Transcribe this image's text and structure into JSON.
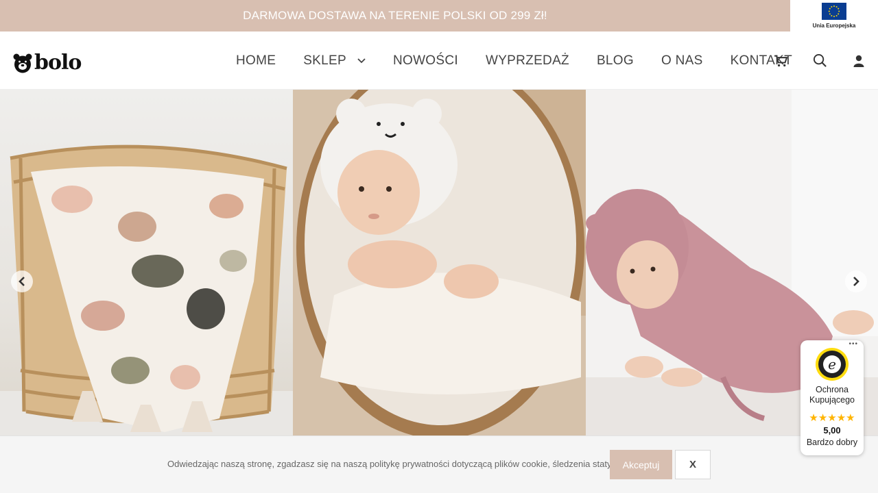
{
  "topbar": {
    "promo_text": "DARMOWA DOSTAWA NA TERENIE POLSKI OD 299 Zł!",
    "eu_label": "Unia Europejska"
  },
  "header": {
    "logo_text": "bolo",
    "nav": [
      {
        "label": "HOME"
      },
      {
        "label": "SKLEP"
      },
      {
        "label": "NOWOŚCI"
      },
      {
        "label": "WYPRZEDAŻ"
      },
      {
        "label": "BLOG"
      },
      {
        "label": "O NAS"
      },
      {
        "label": "KONTAKT"
      }
    ],
    "icons": [
      "cart-icon",
      "search-icon",
      "user-icon"
    ]
  },
  "hero": {
    "slides": [
      "blanket-in-basket",
      "baby-hooded-towel",
      "baby-pink-bathrobe"
    ]
  },
  "cookie": {
    "text": "Odwiedzając naszą stronę, zgadzasz się na naszą politykę prywatności dotyczącą plików cookie, śledzenia statystyk itp.",
    "accept_label": "Akceptuj",
    "close_label": "X"
  },
  "trusted_shops": {
    "label": "Ochrona Kupującego",
    "stars": "★★★★★",
    "score": "5,00",
    "rating_text": "Bardzo dobry",
    "menu": "•••"
  },
  "colors": {
    "accent": "#d8bfb1",
    "text": "#444444"
  }
}
